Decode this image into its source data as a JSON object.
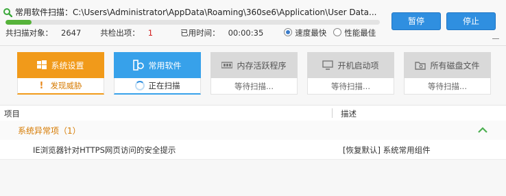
{
  "scan": {
    "title_prefix": "常用软件扫描：",
    "path": "C:\\Users\\Administrator\\AppData\\Roaming\\360se6\\Application\\User Data...",
    "progress": 0.07
  },
  "stats": {
    "scanned_label": "共扫描对象：",
    "scanned_value": "2647",
    "found_label": "共检出项：",
    "found_value": "1",
    "time_label": "已用时间：",
    "time_value": "00:00:35"
  },
  "speed_options": [
    {
      "label": "速度最快",
      "selected": true
    },
    {
      "label": "性能最佳",
      "selected": false
    }
  ],
  "buttons": {
    "pause": "暂停",
    "stop": "停止"
  },
  "tiles": [
    {
      "label": "系统设置",
      "status": "发现威胁",
      "state": "threat"
    },
    {
      "label": "常用软件",
      "status": "正在扫描",
      "state": "scanning"
    },
    {
      "label": "内存活跃程序",
      "status": "等待扫描...",
      "state": "waiting"
    },
    {
      "label": "开机启动项",
      "status": "等待扫描...",
      "state": "waiting"
    },
    {
      "label": "所有磁盘文件",
      "status": "等待扫描...",
      "state": "waiting"
    }
  ],
  "table": {
    "col_item": "项目",
    "col_desc": "描述",
    "group_title": "系统异常项（1）",
    "rows": [
      {
        "item": "IE浏览器针对HTTPS网页访问的安全提示",
        "desc": "[恢复默认] 系统常用组件"
      }
    ]
  },
  "colors": {
    "accent_blue": "#2f8fe0",
    "threat_orange": "#f19a1a",
    "progress_green": "#56b33a"
  }
}
